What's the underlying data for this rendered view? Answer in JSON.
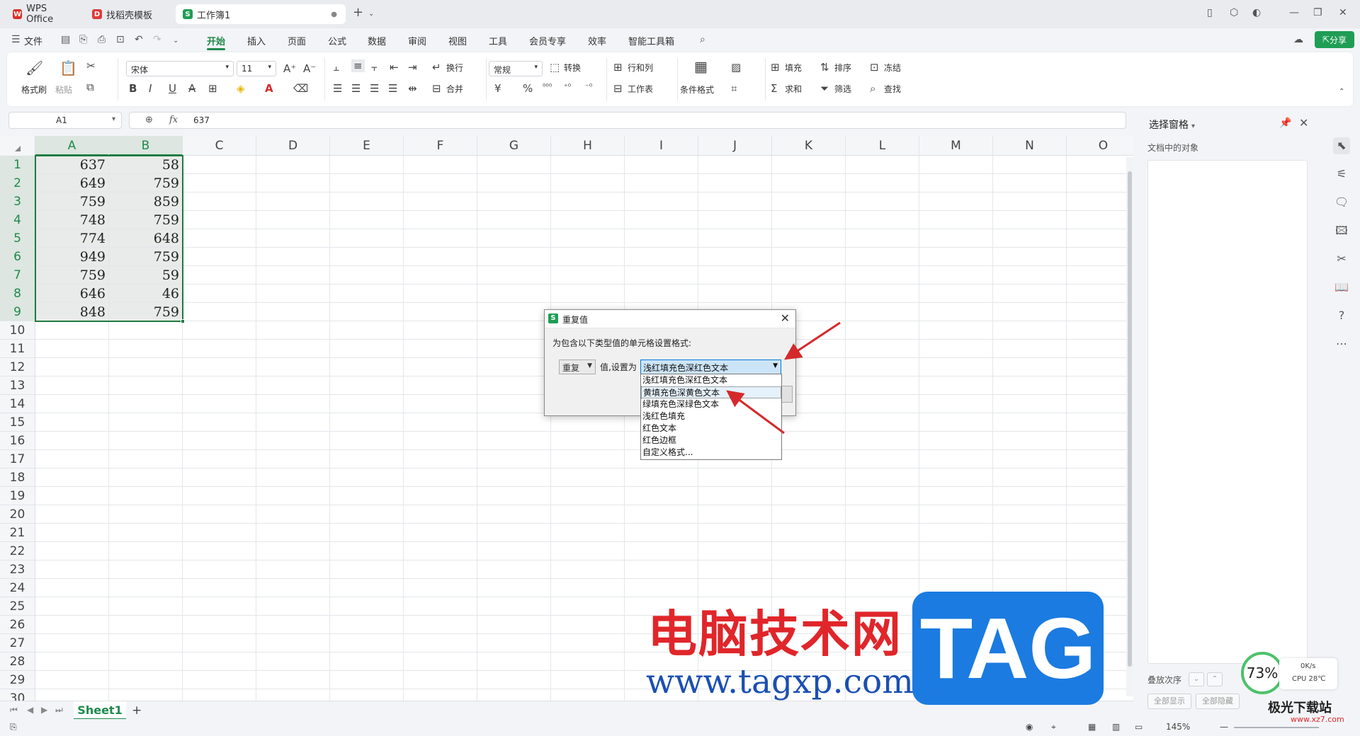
{
  "tabs": [
    {
      "label": "WPS Office",
      "icon": "wps-logo-icon",
      "color": "#d9302b"
    },
    {
      "label": "找稻壳模板",
      "icon": "docer-icon",
      "color": "#e03a3a"
    },
    {
      "label": "工作簿1",
      "icon": "sheet-s-icon",
      "color": "#1f9d55"
    }
  ],
  "menu": {
    "file": "文件",
    "items": [
      "开始",
      "插入",
      "页面",
      "公式",
      "数据",
      "审阅",
      "视图",
      "工具",
      "会员专享",
      "效率",
      "智能工具箱"
    ],
    "active": "开始",
    "share": "分享"
  },
  "ribbon": {
    "format_painter": "格式刷",
    "paste": "粘贴",
    "font_name": "宋体",
    "font_size": "11",
    "wrap": "换行",
    "merge": "合并",
    "number_format": "常规",
    "convert": "转换",
    "row_col": "行和列",
    "worksheet": "工作表",
    "conditional_format": "条件格式",
    "fill": "填充",
    "sort": "排序",
    "freeze": "冻结",
    "sum": "求和",
    "filter": "筛选",
    "find": "查找"
  },
  "formula_bar": {
    "cell_ref": "A1",
    "fx": "fx",
    "value": "637"
  },
  "sheet": {
    "columns": [
      "A",
      "B",
      "C",
      "D",
      "E",
      "F",
      "G",
      "H",
      "I",
      "J",
      "K",
      "L",
      "M",
      "N",
      "O"
    ],
    "rows": [
      "1",
      "2",
      "3",
      "4",
      "5",
      "6",
      "7",
      "8",
      "9",
      "10",
      "11",
      "12",
      "13",
      "14",
      "15",
      "16",
      "17",
      "18",
      "19",
      "20",
      "21",
      "22",
      "23",
      "24",
      "25",
      "26",
      "27",
      "28",
      "29",
      "30"
    ],
    "data": [
      [
        "637",
        "58"
      ],
      [
        "649",
        "759"
      ],
      [
        "759",
        "859"
      ],
      [
        "748",
        "759"
      ],
      [
        "774",
        "648"
      ],
      [
        "949",
        "759"
      ],
      [
        "759",
        "59"
      ],
      [
        "646",
        "46"
      ],
      [
        "848",
        "759"
      ]
    ],
    "tab": "Sheet1",
    "add": "+"
  },
  "dialog": {
    "title": "重复值",
    "description": "为包含以下类型值的单元格设置格式:",
    "type_value": "重复",
    "middle_label": "值,设置为",
    "selected": "浅红填充色深红色文本",
    "options": [
      "浅红填充色深红色文本",
      "黄填充色深黄色文本",
      "绿填充色深绿色文本",
      "浅红色填充",
      "红色文本",
      "红色边框",
      "自定义格式..."
    ],
    "highlighted_index": 1
  },
  "right_panel": {
    "title": "选择窗格",
    "subtitle": "文档中的对象",
    "order_label": "叠放次序",
    "show_all": "全部显示",
    "hide_all": "全部隐藏"
  },
  "status": {
    "zoom": "145%"
  },
  "overlay": {
    "watermark_cn": "电脑技术网",
    "watermark_url": "www.tagxp.com",
    "watermark_tag": "TAG",
    "cpu_percent": "73%",
    "net_speed": "0K/s",
    "cpu_temp": "CPU 28℃",
    "site_logo": "极光下载站",
    "site_url": "www.xz7.com"
  },
  "colors": {
    "accent_green": "#1f8a4c",
    "arrow_red": "#d42a2a",
    "dialog_select_blue": "#cce4f7"
  }
}
